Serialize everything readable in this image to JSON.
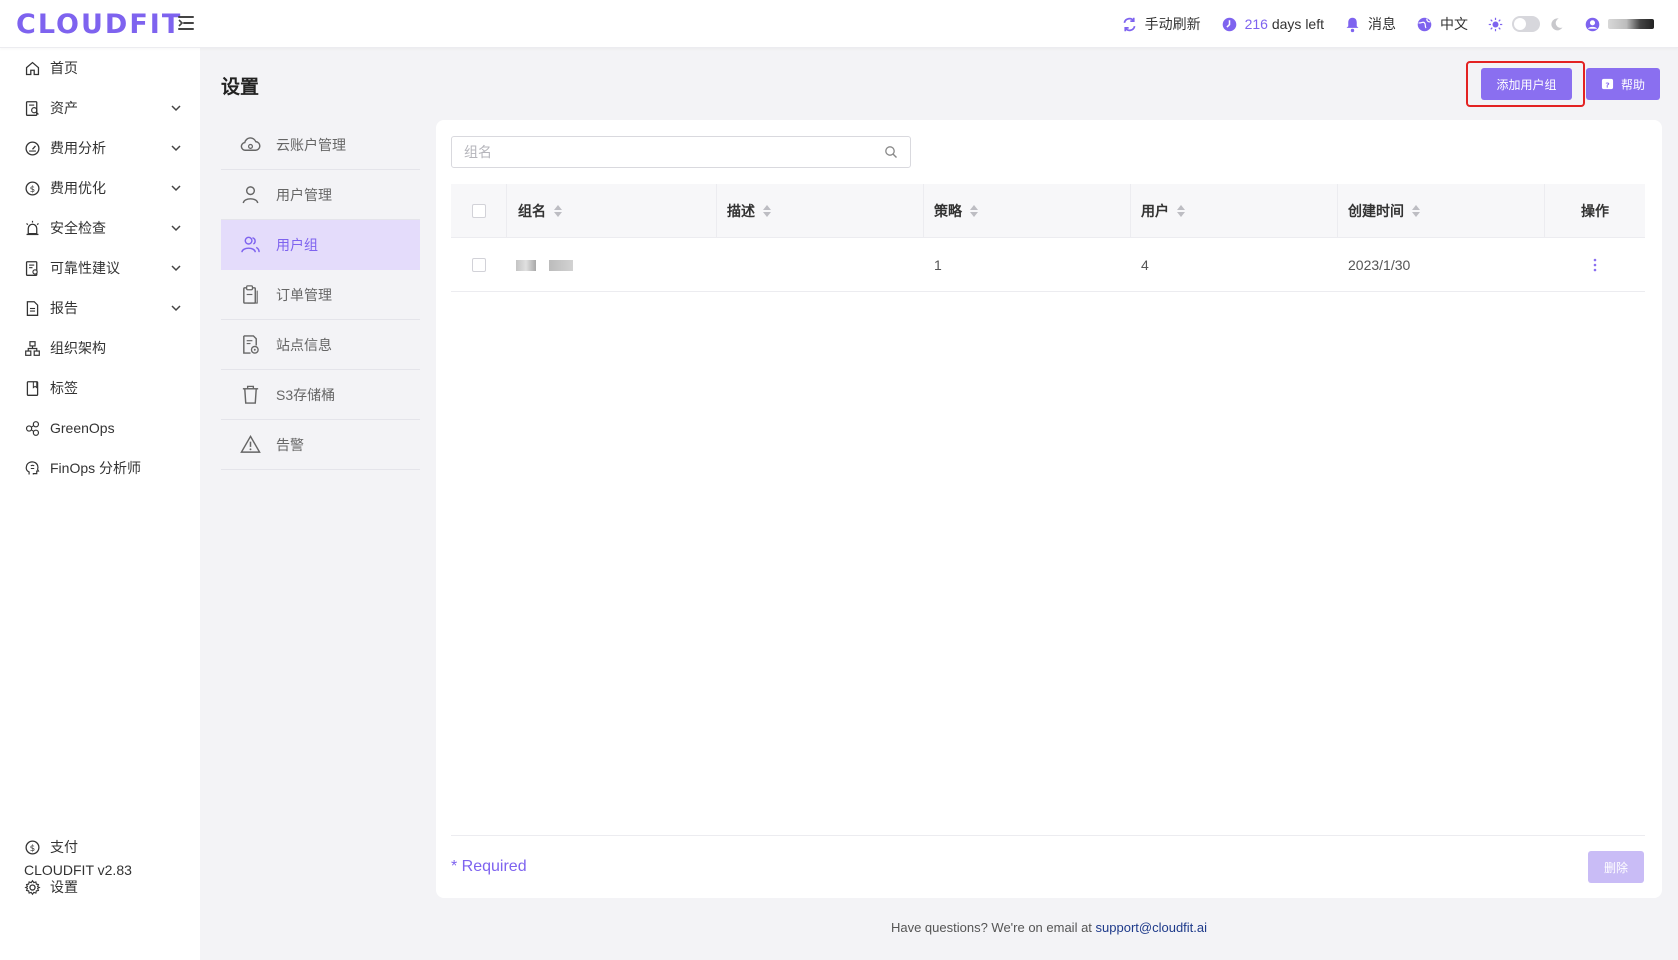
{
  "brand": {
    "logo_text": "CLOUDFIT",
    "accent": "#7e63ef"
  },
  "topbar": {
    "refresh_label": "手动刷新",
    "days_number": "216",
    "days_suffix": "days left",
    "messages_label": "消息",
    "language_label": "中文"
  },
  "sidebar": {
    "items": [
      {
        "label": "首页",
        "icon": "home-icon"
      },
      {
        "label": "资产",
        "icon": "asset-icon",
        "expandable": true
      },
      {
        "label": "费用分析",
        "icon": "gauge-icon",
        "expandable": true
      },
      {
        "label": "费用优化",
        "icon": "dollar-icon",
        "expandable": true
      },
      {
        "label": "安全检查",
        "icon": "alarm-icon",
        "expandable": true
      },
      {
        "label": "可靠性建议",
        "icon": "doc-check-icon",
        "expandable": true
      },
      {
        "label": "报告",
        "icon": "report-icon",
        "expandable": true
      },
      {
        "label": "组织架构",
        "icon": "org-icon"
      },
      {
        "label": "标签",
        "icon": "bookmark-icon"
      },
      {
        "label": "GreenOps",
        "icon": "leaf-icon"
      },
      {
        "label": "FinOps 分析师",
        "icon": "brain-icon"
      }
    ],
    "bottom_items": [
      {
        "label": "支付",
        "icon": "dollar-icon"
      },
      {
        "label": "设置",
        "icon": "gear-icon"
      }
    ],
    "version": "CLOUDFIT v2.83"
  },
  "page": {
    "title": "设置",
    "add_button": "添加用户组",
    "help_button": "帮助"
  },
  "submenu": {
    "items": [
      {
        "label": "云账户管理",
        "icon": "cloud-icon"
      },
      {
        "label": "用户管理",
        "icon": "user-icon"
      },
      {
        "label": "用户组",
        "icon": "users-icon",
        "active": true
      },
      {
        "label": "订单管理",
        "icon": "clipboard-icon"
      },
      {
        "label": "站点信息",
        "icon": "site-icon"
      },
      {
        "label": "S3存储桶",
        "icon": "trash-bucket-icon"
      },
      {
        "label": "告警",
        "icon": "warning-icon"
      }
    ]
  },
  "search": {
    "placeholder": "组名",
    "value": ""
  },
  "table": {
    "columns": [
      "组名",
      "描述",
      "策略",
      "用户",
      "创建时间",
      "操作"
    ],
    "rows": [
      {
        "name": "",
        "description": "",
        "policy": "1",
        "users": "4",
        "created": "2023/1/30"
      }
    ]
  },
  "footer": {
    "required_label": "* Required",
    "delete_button": "删除",
    "question_text": "Have questions? We're on email at",
    "email": "support@cloudfit.ai"
  }
}
